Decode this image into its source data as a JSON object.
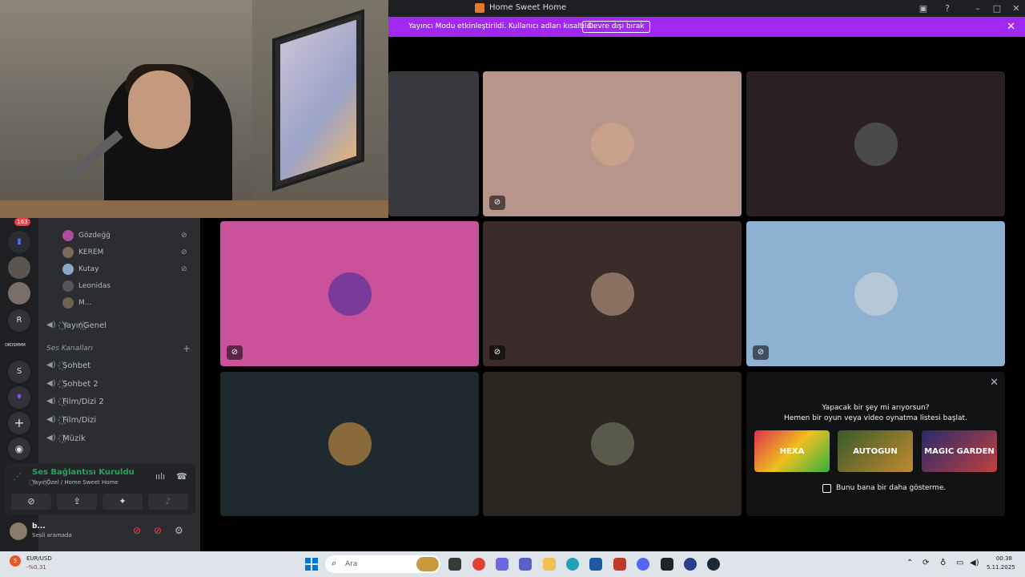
{
  "window": {
    "title": "Home Sweet Home"
  },
  "banner": {
    "text": "Yayıncı Modu etkinleştirildi. Kullanıcı adları kısaltıldı.",
    "button": "Devre dışı bırak"
  },
  "rail": {
    "unread_badge": "163",
    "servers": [
      "R",
      "S"
    ],
    "text_logo": "OKOSMMM"
  },
  "voice_users": [
    "Gözdeğğ",
    "KEREM",
    "Kutay",
    "Leonidas",
    "M..."
  ],
  "channels": {
    "stream_channel": "꙰Yayın꙰Genel",
    "category": "Ses Kanalları",
    "voice_channels": [
      "꙰Sohbet",
      "꙰Sohbet 2",
      "꙰Film/Dizi 2",
      "꙰Film/Dizi",
      "꙰Müzik"
    ]
  },
  "voice_panel": {
    "status": "Ses Bağlantısı Kuruldu",
    "location": "꙰Yayın꙰Özel / Home Sweet Home"
  },
  "user": {
    "name": "b...",
    "status": "Sesli aramada"
  },
  "activity": {
    "heading": "Yapacak bir şey mi arıyorsun?",
    "subheading": "Hemen bir oyun veya video oynatma listesi başlat.",
    "games": [
      "HEXA",
      "AUTOGUN",
      "MAGIC GARDEN"
    ],
    "checkbox_label": "Bunu bana bir daha gösterme."
  },
  "taskbar": {
    "fx_badge": "5",
    "fx_pair": "EUR/USD",
    "fx_change": "-%0,31",
    "search_placeholder": "Ara",
    "time": "00:38",
    "date": "5.11.2025"
  },
  "colors": {
    "banner": "#a128f0",
    "tile_pink": "#c9529a",
    "tile_beige": "#b8958a",
    "tile_blue": "#8fb1d1",
    "connected_green": "#23a55a"
  }
}
